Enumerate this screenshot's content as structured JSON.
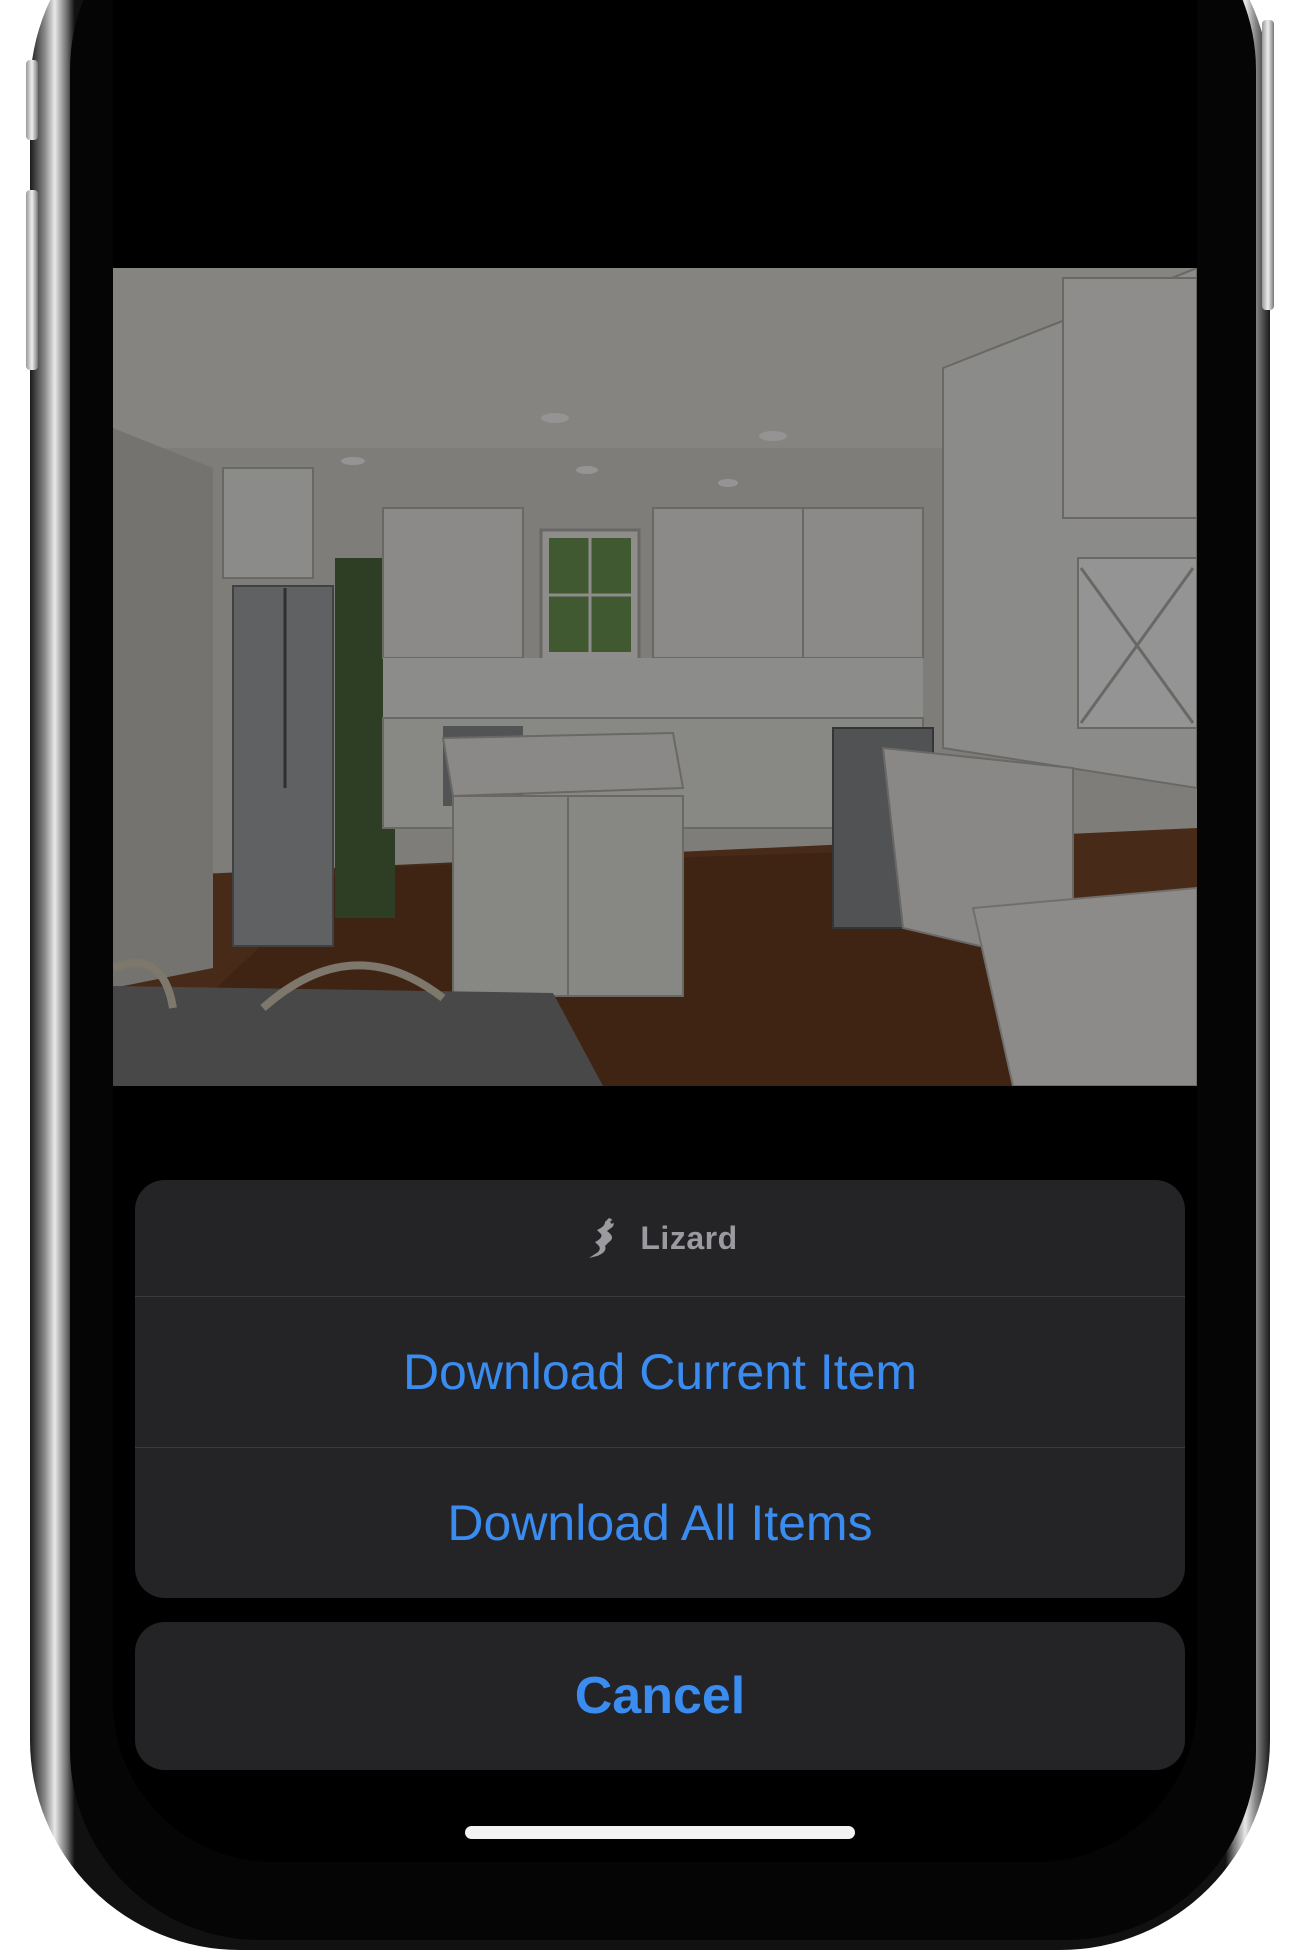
{
  "action_sheet": {
    "app_name": "Lizard",
    "app_icon": "lizard-icon",
    "actions": [
      {
        "label": "Download Current Item"
      },
      {
        "label": "Download All Items"
      }
    ],
    "cancel_label": "Cancel"
  },
  "photo": {
    "subject": "kitchen-photo",
    "dimmed": true
  },
  "colors": {
    "action_text": "#3a8cf0",
    "sheet_background": "#242426",
    "screen_background": "#000000",
    "header_text": "#9a9a9f"
  }
}
